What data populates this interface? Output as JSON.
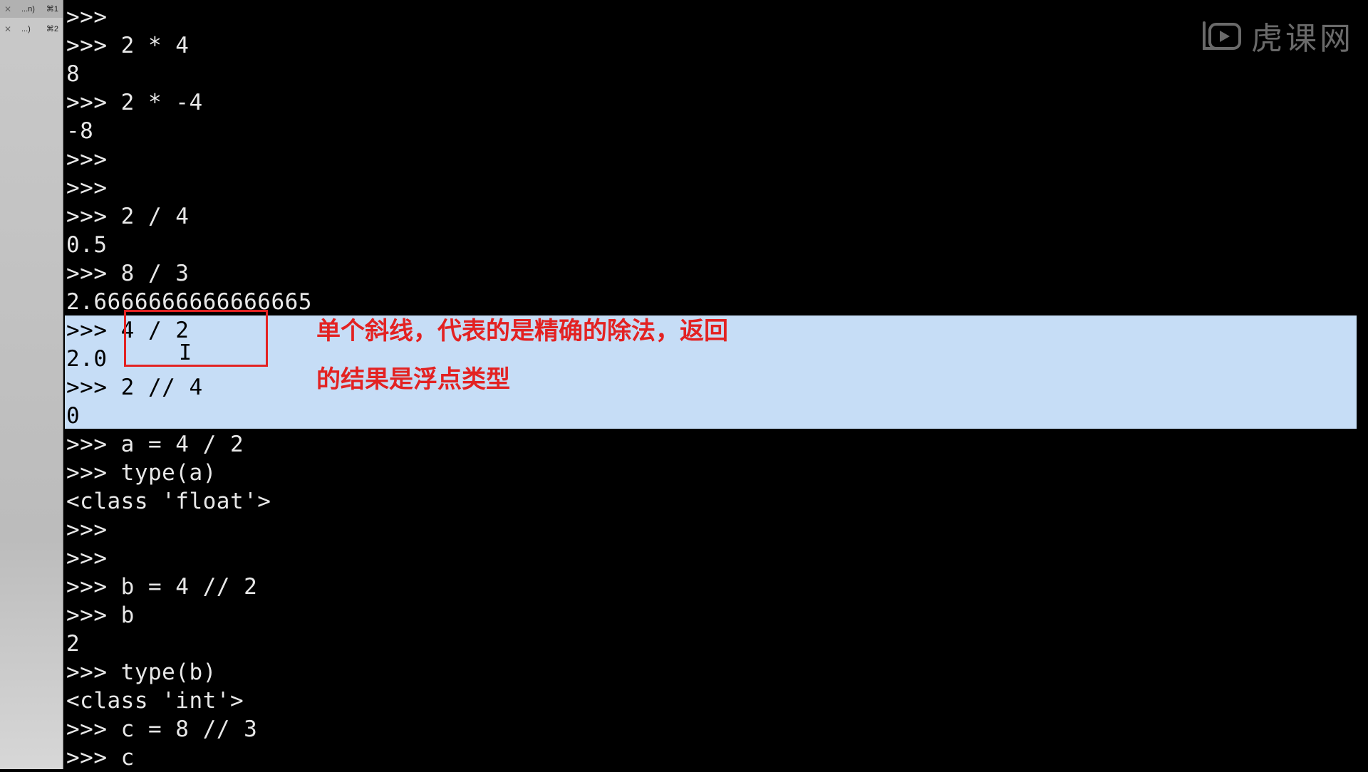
{
  "tabs": [
    {
      "close": "✕",
      "name": "...n)",
      "shortcut": "⌘1",
      "active": true
    },
    {
      "close": "✕",
      "name": "...)",
      "shortcut": "⌘2",
      "active": false
    }
  ],
  "terminal_lines": [
    ">>>",
    ">>> 2 * 4",
    "8",
    ">>> 2 * -4",
    "-8",
    ">>>",
    ">>>",
    ">>> 2 / 4",
    "0.5",
    ">>> 8 / 3",
    "2.6666666666666665",
    ">>> 4 / 2",
    "2.0",
    ">>> 2 // 4",
    "0",
    ">>> a = 4 / 2",
    ">>> type(a)",
    "<class 'float'>",
    ">>>",
    ">>>",
    ">>> b = 4 // 2",
    ">>> b",
    "2",
    ">>> type(b)",
    "<class 'int'>",
    ">>> c = 8 // 3",
    ">>> c"
  ],
  "annotations": {
    "line1": "单个斜线，代表的是精确的除法，返回",
    "line2": "的结果是浮点类型"
  },
  "watermark": {
    "icon": "play-logo-icon",
    "text": "虎课网"
  },
  "colors": {
    "background": "#000000",
    "text": "#e8e8e8",
    "selection": "#c6ddf6",
    "annotation_red": "#e32222",
    "sidebar": "#c4c4c4"
  }
}
